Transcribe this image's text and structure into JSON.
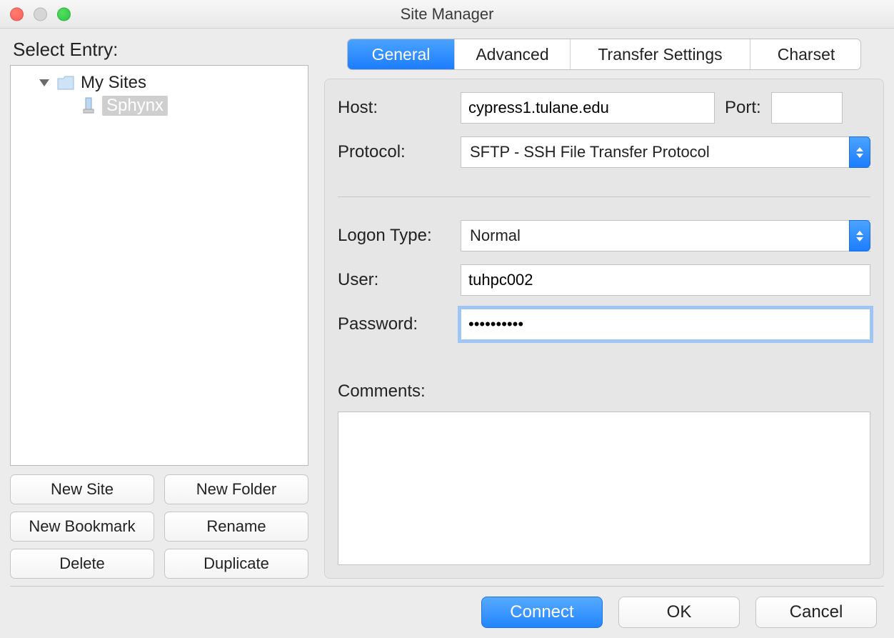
{
  "window": {
    "title": "Site Manager"
  },
  "left": {
    "header": "Select Entry:",
    "tree": {
      "root_label": "My Sites",
      "selected_label": "Sphynx"
    },
    "buttons": {
      "new_site": "New Site",
      "new_folder": "New Folder",
      "new_bookmark": "New Bookmark",
      "rename": "Rename",
      "delete": "Delete",
      "duplicate": "Duplicate"
    }
  },
  "tabs": {
    "general": "General",
    "advanced": "Advanced",
    "transfer": "Transfer Settings",
    "charset": "Charset",
    "active": "general"
  },
  "form": {
    "host_label": "Host:",
    "host_value": "cypress1.tulane.edu",
    "port_label": "Port:",
    "port_value": "",
    "protocol_label": "Protocol:",
    "protocol_value": "SFTP - SSH File Transfer Protocol",
    "logon_type_label": "Logon Type:",
    "logon_type_value": "Normal",
    "user_label": "User:",
    "user_value": "tuhpc002",
    "password_label": "Password:",
    "password_value": "••••••••••",
    "comments_label": "Comments:",
    "comments_value": ""
  },
  "bottom": {
    "connect": "Connect",
    "ok": "OK",
    "cancel": "Cancel"
  }
}
